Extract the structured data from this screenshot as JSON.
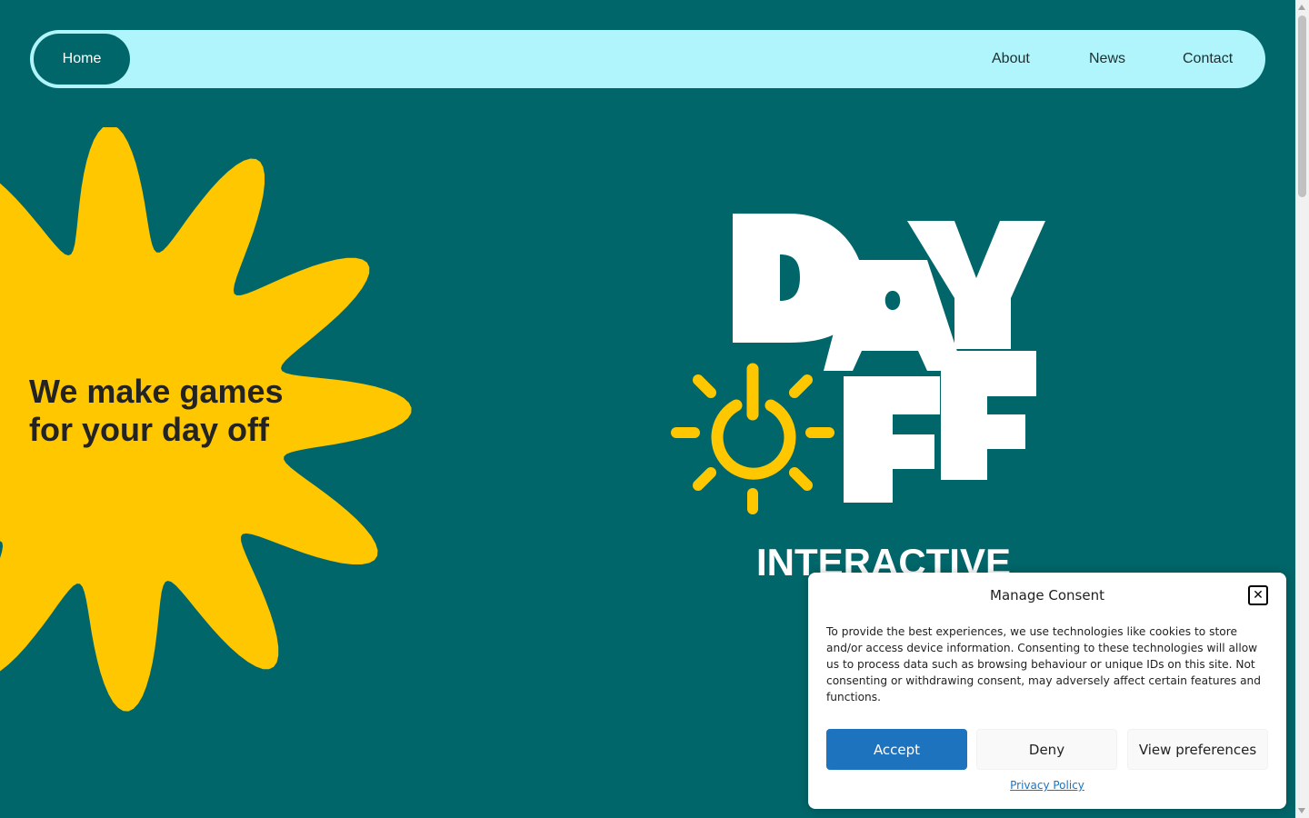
{
  "nav": {
    "home": "Home",
    "links": [
      "About",
      "News",
      "Contact"
    ]
  },
  "hero": {
    "tagline": "We make games for your day off"
  },
  "logo": {
    "line1": "DAY",
    "line2": "FF",
    "line3": "INTERACTIVE"
  },
  "consent": {
    "title": "Manage Consent",
    "close_icon": "close-icon",
    "body": "To provide the best experiences, we use technologies like cookies to store and/or access device information. Consenting to these technologies will allow us to process data such as browsing behaviour or unique IDs on this site. Not consenting or withdrawing consent, may adversely affect certain features and functions.",
    "buttons": {
      "accept": "Accept",
      "deny": "Deny",
      "preferences": "View preferences"
    },
    "privacy_link": "Privacy Policy"
  },
  "colors": {
    "background": "#016669",
    "nav_bg": "#b0f4fc",
    "flower": "#ffc700",
    "accept": "#1e73be"
  }
}
